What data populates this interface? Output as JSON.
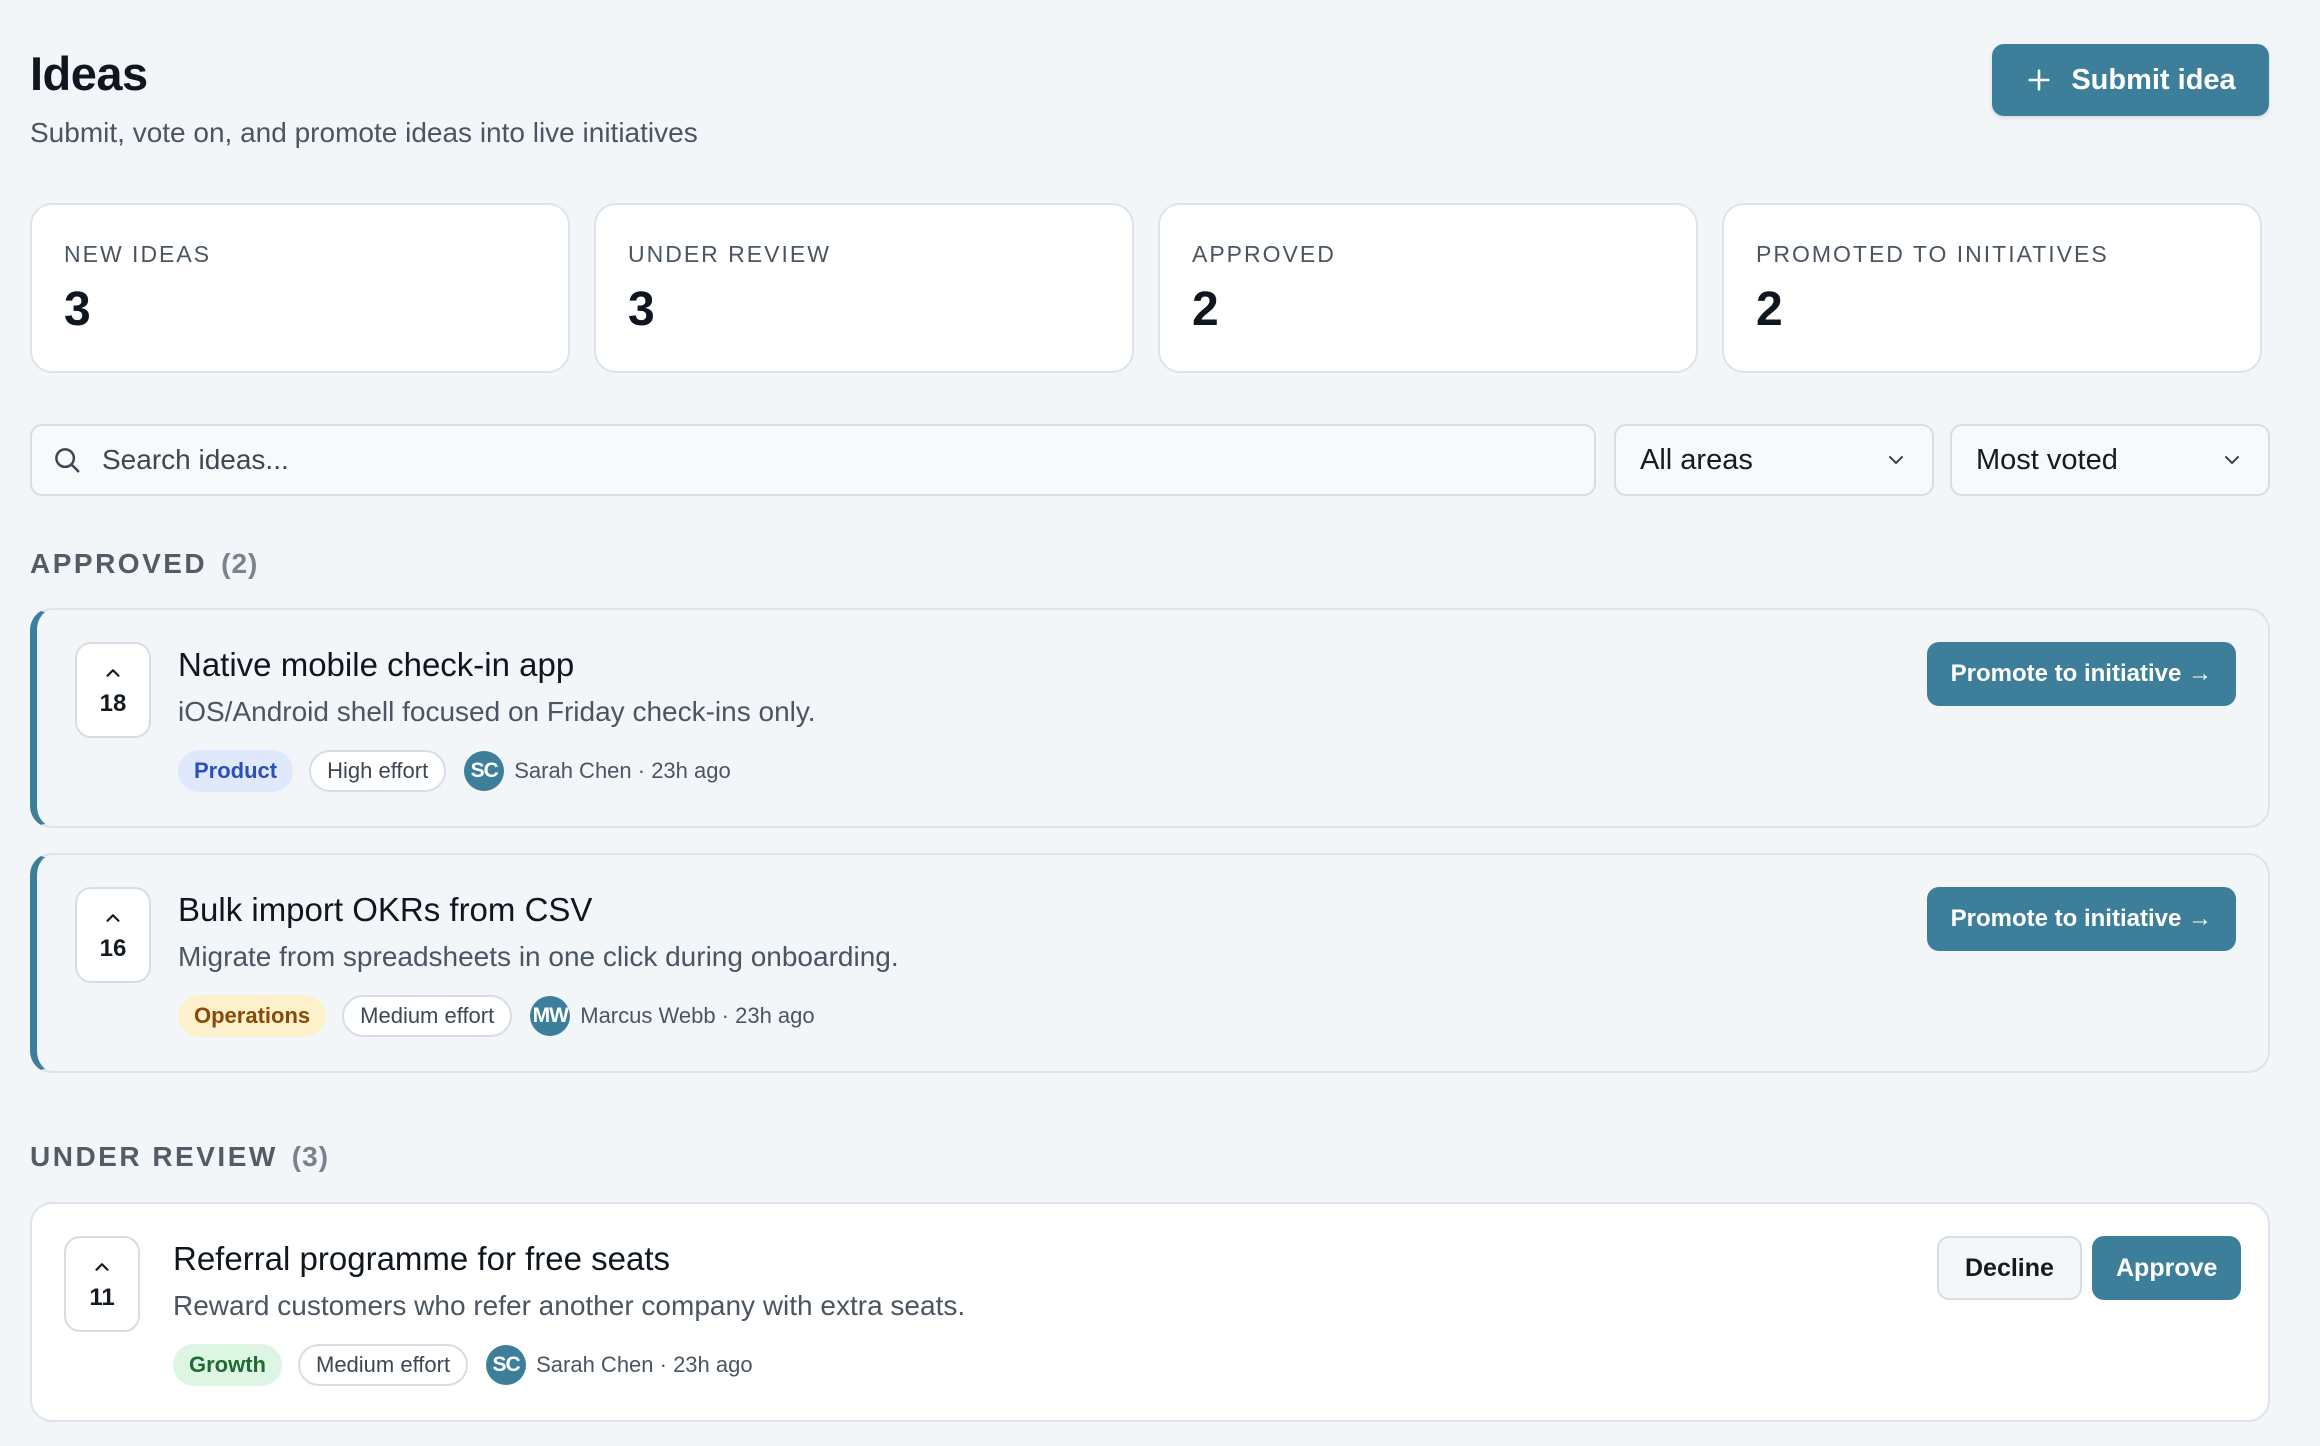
{
  "header": {
    "title": "Ideas",
    "subtitle": "Submit, vote on, and promote ideas into live initiatives",
    "submit_label": "Submit idea"
  },
  "stats": [
    {
      "label": "NEW IDEAS",
      "value": "3"
    },
    {
      "label": "UNDER REVIEW",
      "value": "3"
    },
    {
      "label": "APPROVED",
      "value": "2"
    },
    {
      "label": "PROMOTED TO INITIATIVES",
      "value": "2"
    }
  ],
  "filters": {
    "search_placeholder": "Search ideas...",
    "area_selected": "All areas",
    "sort_selected": "Most voted"
  },
  "sections": {
    "approved": {
      "heading": "APPROVED",
      "count": "(2)",
      "ideas": [
        {
          "votes": "18",
          "title": "Native mobile check-in app",
          "description": "iOS/Android shell focused on Friday check-ins only.",
          "tag": "Product",
          "effort": "High effort",
          "initials": "SC",
          "author_meta": "Sarah Chen · 23h ago",
          "action_label": "Promote to initiative →"
        },
        {
          "votes": "16",
          "title": "Bulk import OKRs from CSV",
          "description": "Migrate from spreadsheets in one click during onboarding.",
          "tag": "Operations",
          "effort": "Medium effort",
          "initials": "MW",
          "author_meta": "Marcus Webb · 23h ago",
          "action_label": "Promote to initiative →"
        }
      ]
    },
    "under_review": {
      "heading": "UNDER REVIEW",
      "count": "(3)",
      "ideas": [
        {
          "votes": "11",
          "title": "Referral programme for free seats",
          "description": "Reward customers who refer another company with extra seats.",
          "tag": "Growth",
          "effort": "Medium effort",
          "initials": "SC",
          "author_meta": "Sarah Chen · 23h ago",
          "decline_label": "Decline",
          "approve_label": "Approve"
        }
      ]
    }
  },
  "colors": {
    "accent": "#3d7f9a",
    "background": "#f3f6f9",
    "tag_product": "#e0e9fb",
    "tag_operations": "#fdf0cc",
    "tag_growth": "#ddf5e3"
  },
  "icons": {
    "submit": "plus-icon",
    "search": "search-icon",
    "select": "chevron-down-icon",
    "upvote": "chevron-up-icon"
  }
}
